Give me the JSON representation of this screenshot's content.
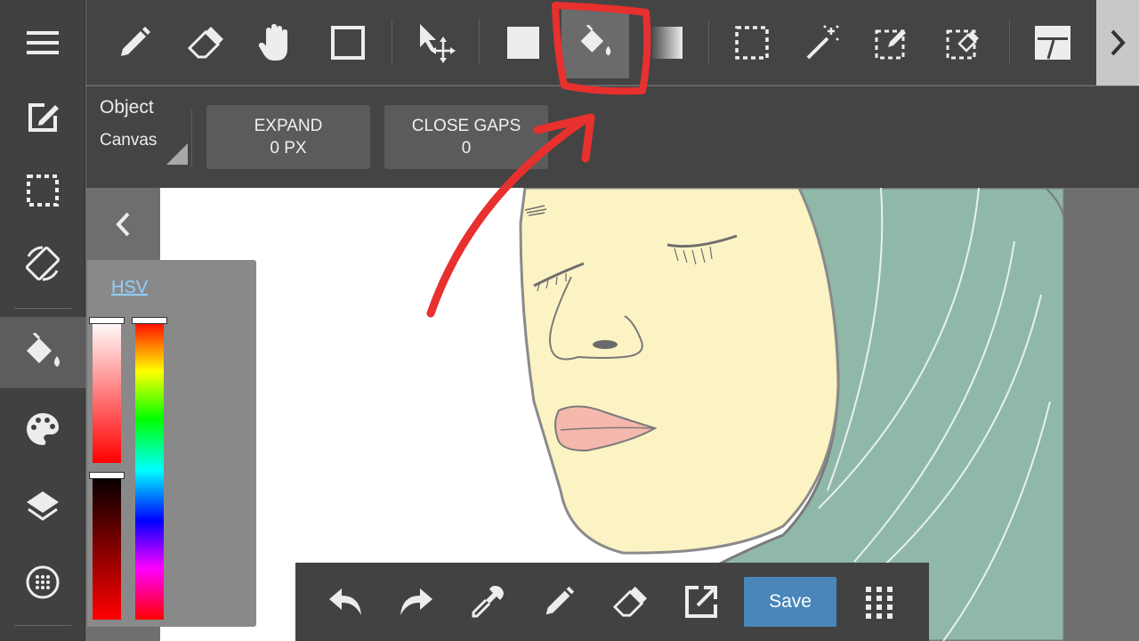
{
  "options": {
    "target_label": "Object",
    "target_value": "Canvas",
    "expand": {
      "label": "EXPAND",
      "value": "0 PX"
    },
    "close_gaps": {
      "label": "CLOSE GAPS",
      "value": "0"
    }
  },
  "color_panel": {
    "mode_label": "HSV"
  },
  "bottom_bar": {
    "save_label": "Save"
  },
  "sidebar": {
    "items": [
      "menu-icon",
      "edit-canvas-icon",
      "selection-icon",
      "rotate-icon",
      "fill-bucket-icon",
      "palette-icon",
      "layers-icon",
      "material-icon"
    ]
  },
  "toolbar": {
    "tools": [
      "pen-icon",
      "eraser-icon",
      "hand-icon",
      "shape-icon",
      "move-icon",
      "fill-color-icon",
      "fill-bucket-icon",
      "gradient-icon",
      "rect-select-icon",
      "magic-wand-icon",
      "select-pen-icon",
      "select-eraser-icon",
      "frame-icon"
    ],
    "active_tool": "fill-bucket-icon"
  },
  "colors": {
    "skin": "#fcf3c4",
    "hijab": "#8fb8a8",
    "lips": "#f5b8ac",
    "annotation": "#e8302e",
    "save_button": "#4a86b9"
  }
}
